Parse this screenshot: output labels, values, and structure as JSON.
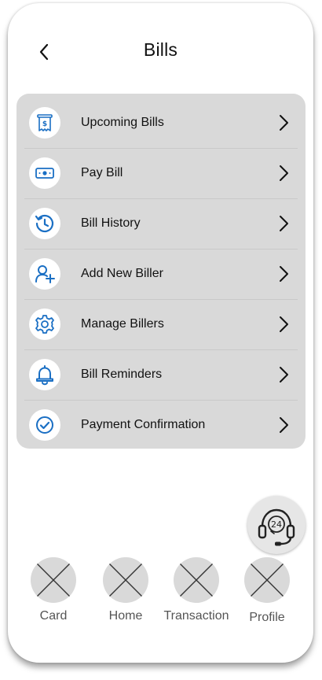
{
  "header": {
    "title": "Bills",
    "back_icon": "chevron-left-icon"
  },
  "menu": {
    "items": [
      {
        "label": "Upcoming Bills",
        "icon": "receipt-icon"
      },
      {
        "label": "Pay Bill",
        "icon": "cash-icon"
      },
      {
        "label": "Bill History",
        "icon": "history-icon"
      },
      {
        "label": "Add New Biller",
        "icon": "add-user-icon"
      },
      {
        "label": "Manage Billers",
        "icon": "gear-icon"
      },
      {
        "label": "Bill Reminders",
        "icon": "bell-icon"
      },
      {
        "label": "Payment Confirmation",
        "icon": "check-circle-icon"
      }
    ]
  },
  "support": {
    "icon": "headset-24-icon",
    "badge": "24"
  },
  "bottom_nav": {
    "items": [
      {
        "label": "Card"
      },
      {
        "label": "Home"
      },
      {
        "label": "Transaction"
      },
      {
        "label": "Profile"
      }
    ]
  },
  "colors": {
    "accent": "#1a6fc4",
    "panel": "#d9d9d9",
    "text": "#111111"
  }
}
